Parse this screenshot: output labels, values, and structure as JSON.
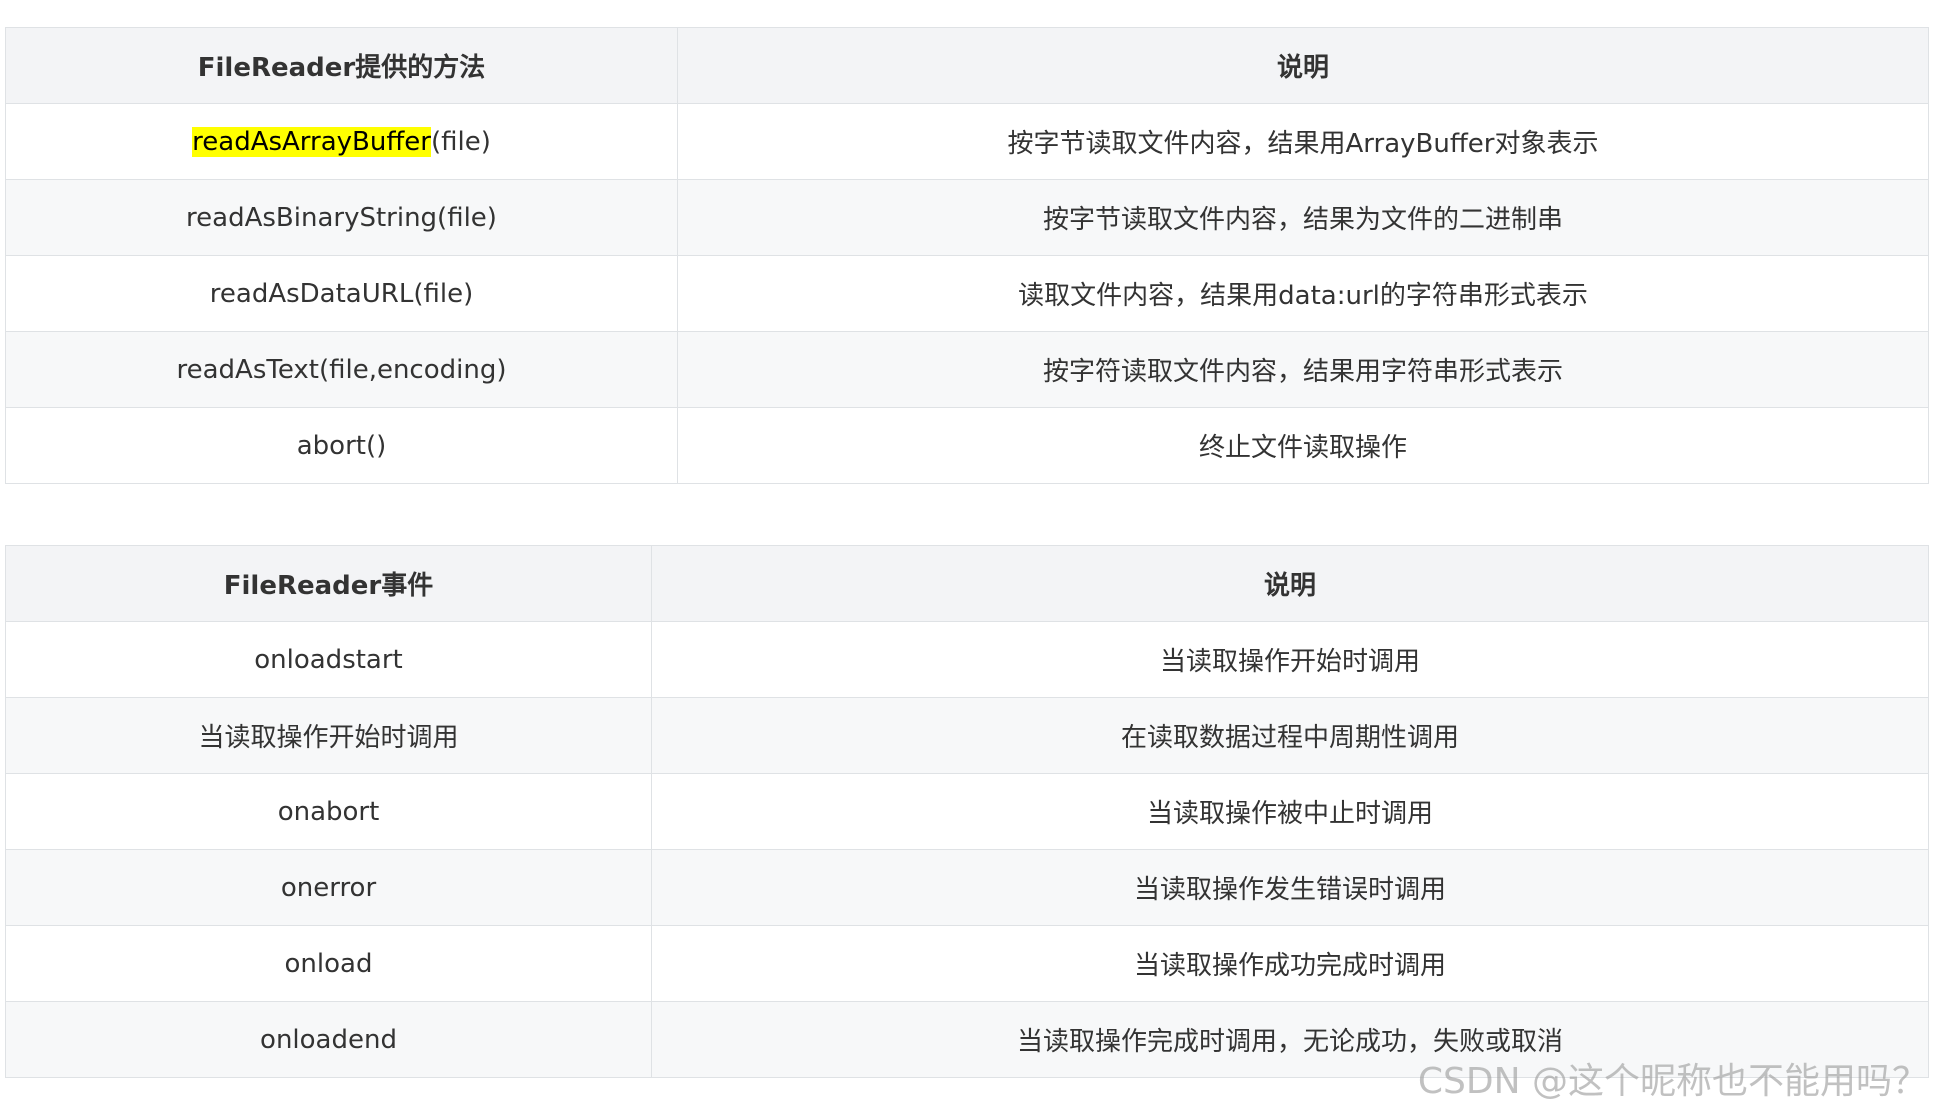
{
  "methods_table": {
    "headers": [
      "FileReader提供的方法",
      "说明"
    ],
    "rows": [
      {
        "method_highlight": "readAsArrayBuffer",
        "method_rest": "(file)",
        "desc": "按字节读取文件内容，结果用ArrayBuffer对象表示"
      },
      {
        "method": "readAsBinaryString(file)",
        "desc": "按字节读取文件内容，结果为文件的二进制串"
      },
      {
        "method": "readAsDataURL(file)",
        "desc": "读取文件内容，结果用data:url的字符串形式表示"
      },
      {
        "method": "readAsText(file,encoding)",
        "desc": "按字符读取文件内容，结果用字符串形式表示"
      },
      {
        "method": "abort()",
        "desc": "终止文件读取操作"
      }
    ]
  },
  "events_table": {
    "headers": [
      "FileReader事件",
      "说明"
    ],
    "rows": [
      {
        "event": "onloadstart",
        "desc": "当读取操作开始时调用"
      },
      {
        "event": "当读取操作开始时调用",
        "desc": "在读取数据过程中周期性调用"
      },
      {
        "event": "onabort",
        "desc": "当读取操作被中止时调用"
      },
      {
        "event": "onerror",
        "desc": "当读取操作发生错误时调用"
      },
      {
        "event": "onload",
        "desc": "当读取操作成功完成时调用"
      },
      {
        "event": "onloadend",
        "desc": "当读取操作完成时调用，无论成功，失败或取消"
      }
    ]
  },
  "watermark": "CSDN @这个昵称也不能用吗？",
  "colors": {
    "highlight": "#ffff00",
    "header_bg": "#f3f4f6",
    "border": "#dfe2e5"
  }
}
